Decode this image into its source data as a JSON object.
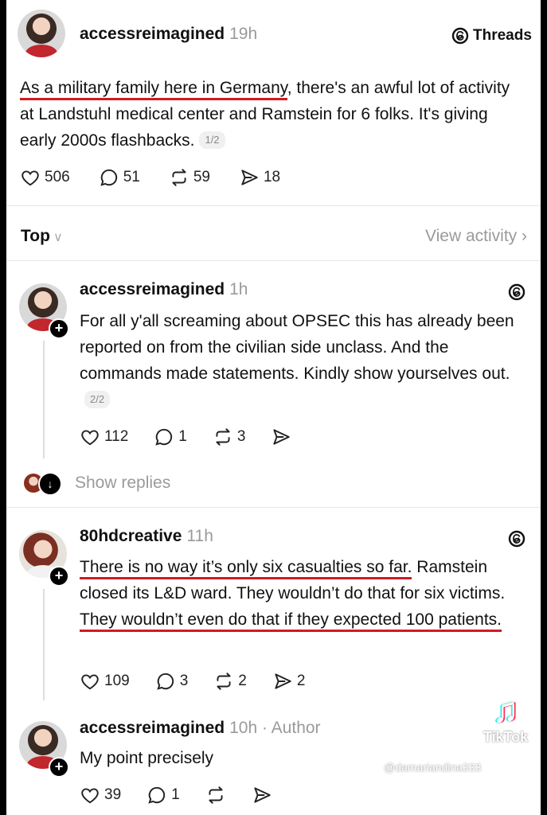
{
  "main_post": {
    "username": "accessreimagined",
    "time": "19h",
    "badge_label": "Threads",
    "text_underlined": "As a military family here in Germany",
    "text_rest": ", there's an awful lot of activity at Landstuhl medical center and Ramstein for 6 folks. It's giving early 2000s flashbacks.",
    "page_indicator": "1/2",
    "likes": "506",
    "comments": "51",
    "reposts": "59",
    "shares": "18"
  },
  "sort_bar": {
    "label": "Top",
    "view_activity": "View activity"
  },
  "reply_1": {
    "username": "accessreimagined",
    "time": "1h",
    "text": "For all y'all screaming about OPSEC this has already been reported on from the civilian side unclass. And the commands made statements. Kindly show yourselves out.",
    "page_indicator": "2/2",
    "likes": "112",
    "comments": "1",
    "reposts": "3"
  },
  "show_replies": "Show replies",
  "reply_2": {
    "username": "80hdcreative",
    "time": "11h",
    "text_underlined_1": "There is no way it’s only six casualties so far.",
    "text_middle": " Ramstein closed its L&D ward. They wouldn’t do that for six victims. ",
    "text_underlined_2": "They wouldn’t even do that if they expected 100 patients.",
    "likes": "109",
    "comments": "3",
    "reposts": "2",
    "shares": "2"
  },
  "reply_3": {
    "username": "accessreimagined",
    "time": "10h",
    "author_label": "· Author",
    "text": "My point precisely",
    "likes": "39",
    "comments": "1"
  },
  "watermark": {
    "brand": "TikTok",
    "handle": "@damariandina333"
  },
  "colors": {
    "underline": "#d01a22",
    "muted": "#9a9a9a"
  }
}
